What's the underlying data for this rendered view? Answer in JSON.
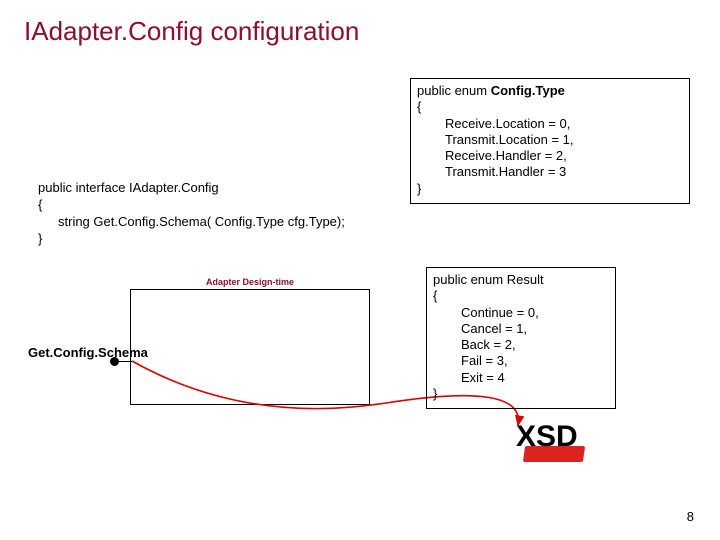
{
  "title": "IAdapter.Config configuration",
  "interface_code": {
    "line1": "public interface IAdapter.Config",
    "open": "{",
    "method": "string Get.Config.Schema( Config.Type cfg.Type);",
    "close": "}"
  },
  "enum_configtype": {
    "decl_prefix": "public enum ",
    "decl_name": "Config.Type",
    "open": "{",
    "members": [
      "Receive.Location = 0,",
      "Transmit.Location = 1,",
      "Receive.Handler = 2,",
      "Transmit.Handler = 3"
    ],
    "close": "}"
  },
  "enum_result": {
    "decl_prefix": "public enum ",
    "decl_name": "Result",
    "open": "{",
    "members": [
      "Continue = 0,",
      "Cancel   = 1,",
      "Back    = 2,",
      "Fail     = 3,",
      "Exit   = 4"
    ],
    "close": "}"
  },
  "diagram": {
    "label": "Adapter Design-time"
  },
  "lollipop_label": "Get.Config.Schema",
  "xsd_label": "XSD",
  "page_number": "8",
  "chart_data": {
    "type": "diagram",
    "title": "IAdapter.Config configuration",
    "interface": {
      "name": "IAdapter.Config",
      "method": "string Get.Config.Schema(Config.Type cfg.Type)"
    },
    "enums": [
      {
        "name": "Config.Type",
        "values": {
          "Receive.Location": 0,
          "Transmit.Location": 1,
          "Receive.Handler": 2,
          "Transmit.Handler": 3
        }
      },
      {
        "name": "Result",
        "values": {
          "Continue": 0,
          "Cancel": 1,
          "Back": 2,
          "Fail": 3,
          "Exit": 4
        }
      }
    ],
    "component": "Adapter Design-time",
    "provided_interface": "Get.Config.Schema",
    "output": "XSD"
  }
}
